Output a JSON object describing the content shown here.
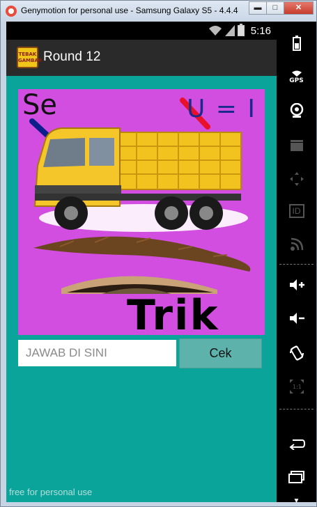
{
  "window": {
    "title": "Genymotion for personal use - Samsung Galaxy S5 - 4.4.4 -",
    "minimize_glyph": "▬",
    "maximize_glyph": "□",
    "close_glyph": "✕"
  },
  "statusbar": {
    "time": "5:16"
  },
  "actionbar": {
    "title": "Round 12",
    "app_icon_text": "TEBAK GAMBAR"
  },
  "puzzle": {
    "text_se": "Se",
    "text_ui": "U = I",
    "text_trik": "Trik",
    "background_color": "#d14ee0"
  },
  "answer": {
    "placeholder": "JAWAB DI SINI",
    "value": ""
  },
  "check_button": {
    "label": "Cek"
  },
  "footer": {
    "watermark": "free for personal use"
  },
  "sidebar": {
    "gps_label": "GPS",
    "id_label": "ID",
    "items": [
      "battery-icon",
      "gps-icon",
      "camera-icon",
      "video-icon",
      "dpad-icon",
      "id-icon",
      "cast-icon",
      "volume-up-icon",
      "volume-down-icon",
      "rotate-icon",
      "scale-icon",
      "back-icon",
      "recent-apps-icon"
    ]
  },
  "colors": {
    "accent": "#0aa49b",
    "button": "#5db3ab",
    "actionbar": "#2a2a2a"
  }
}
